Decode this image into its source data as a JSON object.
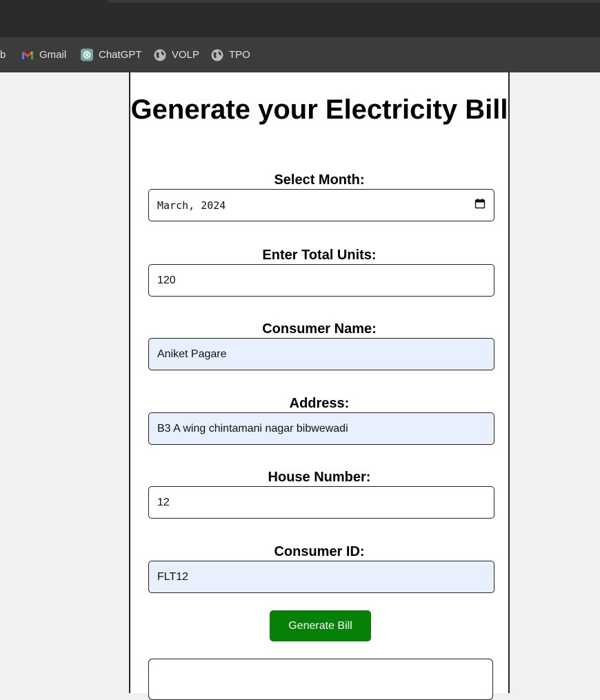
{
  "browser": {
    "bookmarks": [
      {
        "label": "b",
        "icon": "partial-bookmark-icon"
      },
      {
        "label": "Gmail",
        "icon": "gmail-icon"
      },
      {
        "label": "ChatGPT",
        "icon": "chatgpt-icon"
      },
      {
        "label": "VOLP",
        "icon": "globe-icon"
      },
      {
        "label": "TPO",
        "icon": "globe-icon"
      }
    ]
  },
  "form": {
    "title": "Generate your Electricity Bill",
    "month": {
      "label": "Select Month:",
      "value": "March, 2024"
    },
    "units": {
      "label": "Enter Total Units:",
      "value": "120"
    },
    "name": {
      "label": "Consumer Name:",
      "value": "Aniket Pagare"
    },
    "address": {
      "label": "Address:",
      "value": "B3 A wing chintamani nagar bibwewadi"
    },
    "house": {
      "label": "House Number:",
      "value": "12"
    },
    "consumer_id": {
      "label": "Consumer ID:",
      "value": "FLT12"
    },
    "submit_label": "Generate Bill"
  },
  "colors": {
    "button_bg": "#078008",
    "autofill_bg": "#e8f0fe"
  }
}
